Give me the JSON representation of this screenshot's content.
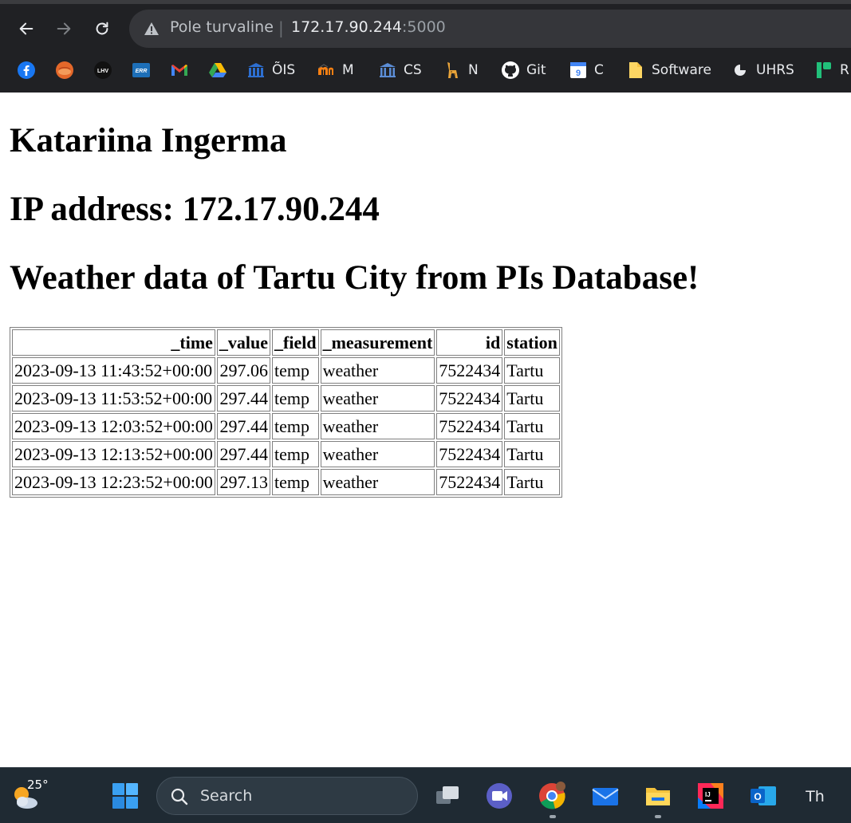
{
  "browser": {
    "security_status": "Pole turvaline",
    "url_host": "172.17.90.244",
    "url_port": ":5000"
  },
  "bookmarks": [
    {
      "icon": "facebook-icon",
      "label": ""
    },
    {
      "icon": "orange-globe-icon",
      "label": ""
    },
    {
      "icon": "lhv-icon",
      "label": ""
    },
    {
      "icon": "err-icon",
      "label": ""
    },
    {
      "icon": "gmail-icon",
      "label": ""
    },
    {
      "icon": "google-drive-icon",
      "label": ""
    },
    {
      "icon": "ois-building-icon",
      "label": "ÕIS"
    },
    {
      "icon": "moodle-icon",
      "label": "M"
    },
    {
      "icon": "cs-building-icon",
      "label": "CS"
    },
    {
      "icon": "giraffe-icon",
      "label": "N"
    },
    {
      "icon": "github-icon",
      "label": "Git"
    },
    {
      "icon": "calendar-icon",
      "label": "C"
    },
    {
      "icon": "folder-icon",
      "label": "Software"
    },
    {
      "icon": "uhrs-icon",
      "label": "UHRS"
    },
    {
      "icon": "green-r-icon",
      "label": "R"
    }
  ],
  "page": {
    "name_heading": "Katariina Ingerma",
    "ip_heading": "IP address: 172.17.90.244",
    "weather_heading": "Weather data of Tartu City from PIs Database!",
    "table": {
      "columns": [
        "_time",
        "_value",
        "_field",
        "_measurement",
        "id",
        "station"
      ],
      "rows": [
        [
          "2023-09-13 11:43:52+00:00",
          "297.06",
          "temp",
          "weather",
          "7522434",
          "Tartu"
        ],
        [
          "2023-09-13 11:53:52+00:00",
          "297.44",
          "temp",
          "weather",
          "7522434",
          "Tartu"
        ],
        [
          "2023-09-13 12:03:52+00:00",
          "297.44",
          "temp",
          "weather",
          "7522434",
          "Tartu"
        ],
        [
          "2023-09-13 12:13:52+00:00",
          "297.44",
          "temp",
          "weather",
          "7522434",
          "Tartu"
        ],
        [
          "2023-09-13 12:23:52+00:00",
          "297.13",
          "temp",
          "weather",
          "7522434",
          "Tartu"
        ]
      ]
    }
  },
  "taskbar": {
    "weather_temp": "25°",
    "search_label": "Search",
    "apps": [
      "task-view-icon",
      "video-call-icon",
      "chrome-icon",
      "mail-icon",
      "file-explorer-icon",
      "intellij-icon",
      "outlook-icon",
      "th-icon"
    ]
  }
}
